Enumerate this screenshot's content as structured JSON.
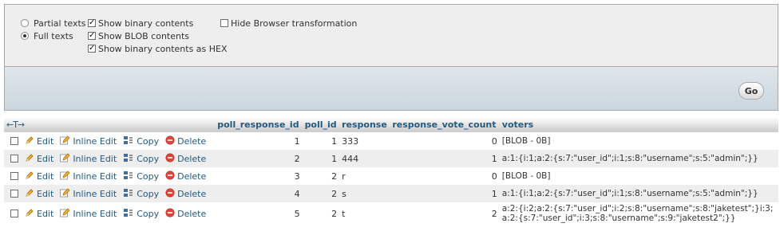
{
  "options": {
    "partial_texts": "Partial texts",
    "full_texts": "Full texts",
    "show_binary": "Show binary contents",
    "show_blob": "Show BLOB contents",
    "show_binary_hex": "Show binary contents as HEX",
    "hide_browser_transformation": "Hide Browser transformation"
  },
  "go_label": "Go",
  "column_arrows": "←T→",
  "columns": [
    "poll_response_id",
    "poll_id",
    "response",
    "response_vote_count",
    "voters"
  ],
  "actions": {
    "edit": "Edit",
    "inline_edit": "Inline Edit",
    "copy": "Copy",
    "delete": "Delete"
  },
  "rows": [
    {
      "poll_response_id": "1",
      "poll_id": "1",
      "response": "333",
      "response_vote_count": "0",
      "voters": "[BLOB - 0B]"
    },
    {
      "poll_response_id": "2",
      "poll_id": "1",
      "response": "444",
      "response_vote_count": "1",
      "voters": "a:1:{i:1;a:2:{s:7:\"user_id\";i:1;s:8:\"username\";s:5:\"admin\";}}"
    },
    {
      "poll_response_id": "3",
      "poll_id": "2",
      "response": "r",
      "response_vote_count": "0",
      "voters": "[BLOB - 0B]"
    },
    {
      "poll_response_id": "4",
      "poll_id": "2",
      "response": "s",
      "response_vote_count": "1",
      "voters": "a:1:{i:1;a:2:{s:7:\"user_id\";i:1;s:8:\"username\";s:5:\"admin\";}}"
    },
    {
      "poll_response_id": "5",
      "poll_id": "2",
      "response": "t",
      "response_vote_count": "2",
      "voters": "a:2:{i:2;a:2:{s:7:\"user_id\";i:2;s:8:\"username\";s:8:\"jaketest\";}i:3;a:2:{s:7:\"user_id\";i:3;s:8:\"username\";s:9:\"jaketest2\";}}"
    }
  ]
}
